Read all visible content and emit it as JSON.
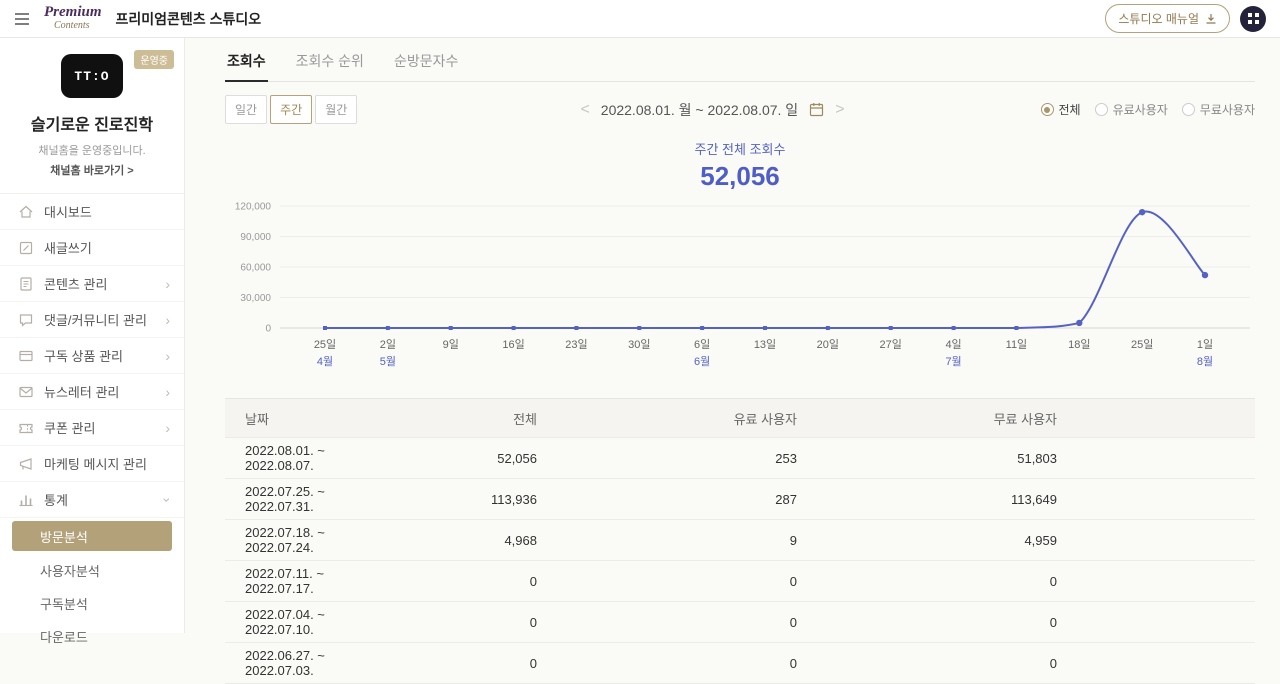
{
  "header": {
    "logo_line1": "Premium",
    "logo_line2": "Contents",
    "title": "프리미엄콘텐츠 스튜디오",
    "manual_button": "스튜디오 매뉴얼"
  },
  "sidebar": {
    "badge": "운영중",
    "channel_logo_text": "TT:O",
    "channel_name": "슬기로운 진로진학",
    "channel_desc": "채널홈을 운영중입니다.",
    "channel_link": "채널홈 바로가기 >",
    "menu": [
      {
        "key": "dashboard",
        "label": "대시보드",
        "icon": "dashboard-icon",
        "chevron": false
      },
      {
        "key": "new-post",
        "label": "새글쓰기",
        "icon": "write-icon",
        "chevron": false
      },
      {
        "key": "content-management",
        "label": "콘텐츠 관리",
        "icon": "content-icon",
        "chevron": "right"
      },
      {
        "key": "comments-community",
        "label": "댓글/커뮤니티 관리",
        "icon": "comment-icon",
        "chevron": "right"
      },
      {
        "key": "subscription-products",
        "label": "구독 상품 관리",
        "icon": "subscription-icon",
        "chevron": "right"
      },
      {
        "key": "newsletter",
        "label": "뉴스레터 관리",
        "icon": "newsletter-icon",
        "chevron": "right"
      },
      {
        "key": "coupon",
        "label": "쿠폰 관리",
        "icon": "coupon-icon",
        "chevron": "right"
      },
      {
        "key": "marketing-messages",
        "label": "마케팅 메시지 관리",
        "icon": "marketing-icon",
        "chevron": false
      },
      {
        "key": "statistics",
        "label": "통계",
        "icon": "stats-icon",
        "chevron": "down"
      }
    ],
    "submenu": [
      {
        "key": "visit-analysis",
        "label": "방문분석",
        "active": true
      },
      {
        "key": "user-analysis",
        "label": "사용자분석",
        "active": false
      },
      {
        "key": "subscription-analysis",
        "label": "구독분석",
        "active": false
      },
      {
        "key": "download",
        "label": "다운로드",
        "active": false
      }
    ]
  },
  "tabs": [
    {
      "key": "views",
      "label": "조회수",
      "active": true
    },
    {
      "key": "views-rank",
      "label": "조회수 순위",
      "active": false
    },
    {
      "key": "unique-visitors",
      "label": "순방문자수",
      "active": false
    }
  ],
  "controls": {
    "period_buttons": [
      {
        "key": "daily",
        "label": "일간",
        "active": false
      },
      {
        "key": "weekly",
        "label": "주간",
        "active": true
      },
      {
        "key": "monthly",
        "label": "월간",
        "active": false
      }
    ],
    "date_range": "2022.08.01. 월 ~ 2022.08.07. 일",
    "radios": [
      {
        "key": "all",
        "label": "전체",
        "selected": true
      },
      {
        "key": "paid-users",
        "label": "유료사용자",
        "selected": false
      },
      {
        "key": "free-users",
        "label": "무료사용자",
        "selected": false
      }
    ]
  },
  "summary": {
    "label": "주간 전체 조회수",
    "value": "52,056"
  },
  "chart_data": {
    "type": "line",
    "title": "주간 전체 조회수",
    "x": [
      "25일",
      "2일",
      "9일",
      "16일",
      "23일",
      "30일",
      "6일",
      "13일",
      "20일",
      "27일",
      "4일",
      "11일",
      "18일",
      "25일",
      "1일"
    ],
    "month_labels": {
      "0": "4월",
      "1": "5월",
      "6": "6월",
      "10": "7월",
      "14": "8월"
    },
    "values": [
      0,
      0,
      0,
      0,
      0,
      0,
      0,
      0,
      0,
      0,
      0,
      0,
      4968,
      113936,
      52056
    ],
    "ylim": [
      0,
      120000
    ],
    "yticks": [
      0,
      30000,
      60000,
      90000,
      120000
    ],
    "line_color": "#5562c4",
    "grid": true,
    "legend": "none"
  },
  "table": {
    "headers": [
      "날짜",
      "전체",
      "유료 사용자",
      "무료 사용자"
    ],
    "rows": [
      [
        "2022.08.01. ~ 2022.08.07.",
        "52,056",
        "253",
        "51,803"
      ],
      [
        "2022.07.25. ~ 2022.07.31.",
        "113,936",
        "287",
        "113,649"
      ],
      [
        "2022.07.18. ~ 2022.07.24.",
        "4,968",
        "9",
        "4,959"
      ],
      [
        "2022.07.11. ~ 2022.07.17.",
        "0",
        "0",
        "0"
      ],
      [
        "2022.07.04. ~ 2022.07.10.",
        "0",
        "0",
        "0"
      ],
      [
        "2022.06.27. ~ 2022.07.03.",
        "0",
        "0",
        "0"
      ]
    ]
  },
  "colors": {
    "accent_gold": "#ab9568",
    "submenu_active": "#b2a179",
    "badge": "#cdbd97",
    "chart_blue": "#5562c4"
  }
}
